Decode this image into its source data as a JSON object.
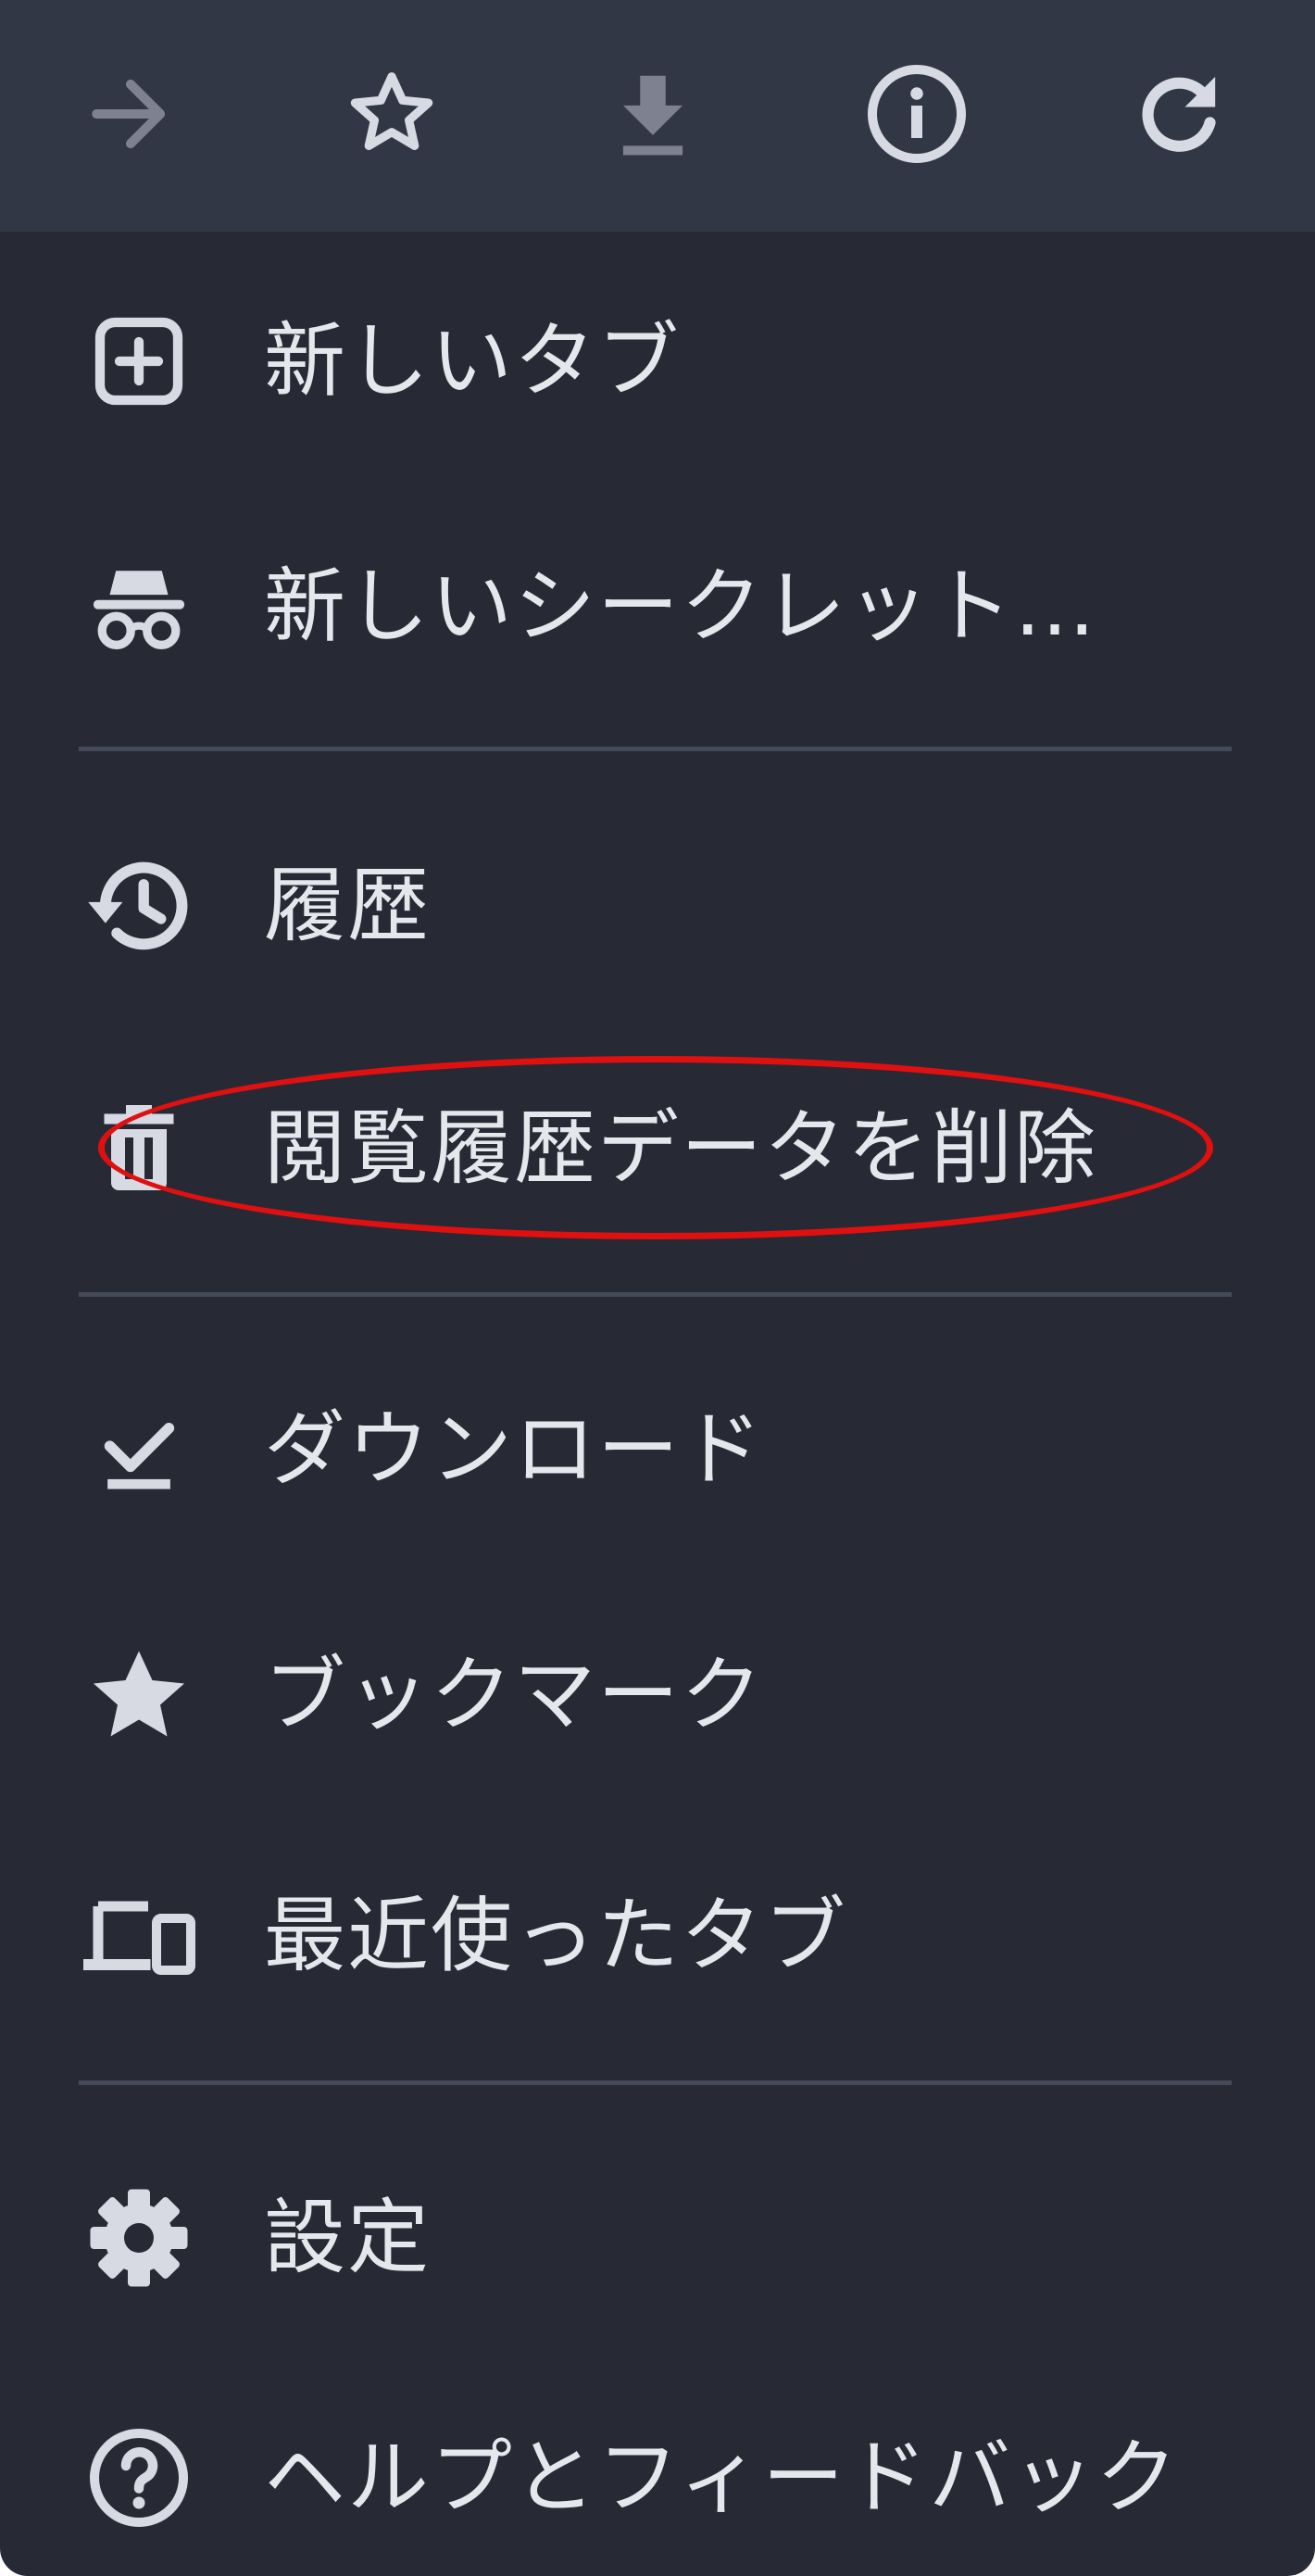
{
  "toolbar": {
    "buttons": [
      {
        "icon": "forward-arrow-icon",
        "state": "disabled"
      },
      {
        "icon": "bookmark-star-outline-icon",
        "state": "enabled"
      },
      {
        "icon": "download-icon",
        "state": "disabled"
      },
      {
        "icon": "info-icon",
        "state": "enabled"
      },
      {
        "icon": "reload-icon",
        "state": "enabled"
      }
    ]
  },
  "menu": {
    "items": [
      {
        "label": "新しいタブ",
        "icon": "new-tab-icon"
      },
      {
        "label": "新しいシークレット…",
        "icon": "incognito-icon"
      },
      {
        "label": "履歴",
        "icon": "history-icon"
      },
      {
        "label": "閲覧履歴データを削除",
        "icon": "trash-icon",
        "highlighted": true
      },
      {
        "label": "ダウンロード",
        "icon": "downloads-icon"
      },
      {
        "label": "ブックマーク",
        "icon": "bookmarks-star-icon"
      },
      {
        "label": "最近使ったタブ",
        "icon": "recent-tabs-devices-icon"
      },
      {
        "label": "設定",
        "icon": "settings-gear-icon"
      },
      {
        "label": "ヘルプとフィードバック",
        "icon": "help-icon"
      }
    ]
  },
  "colors": {
    "menu_background": "#272a35",
    "toolbar_background": "#323746",
    "text": "#e6e7ed",
    "icon_enabled": "#d8dae3",
    "icon_disabled": "#7d8190",
    "divider": "#454a58",
    "highlight_annotation": "#e01010"
  }
}
